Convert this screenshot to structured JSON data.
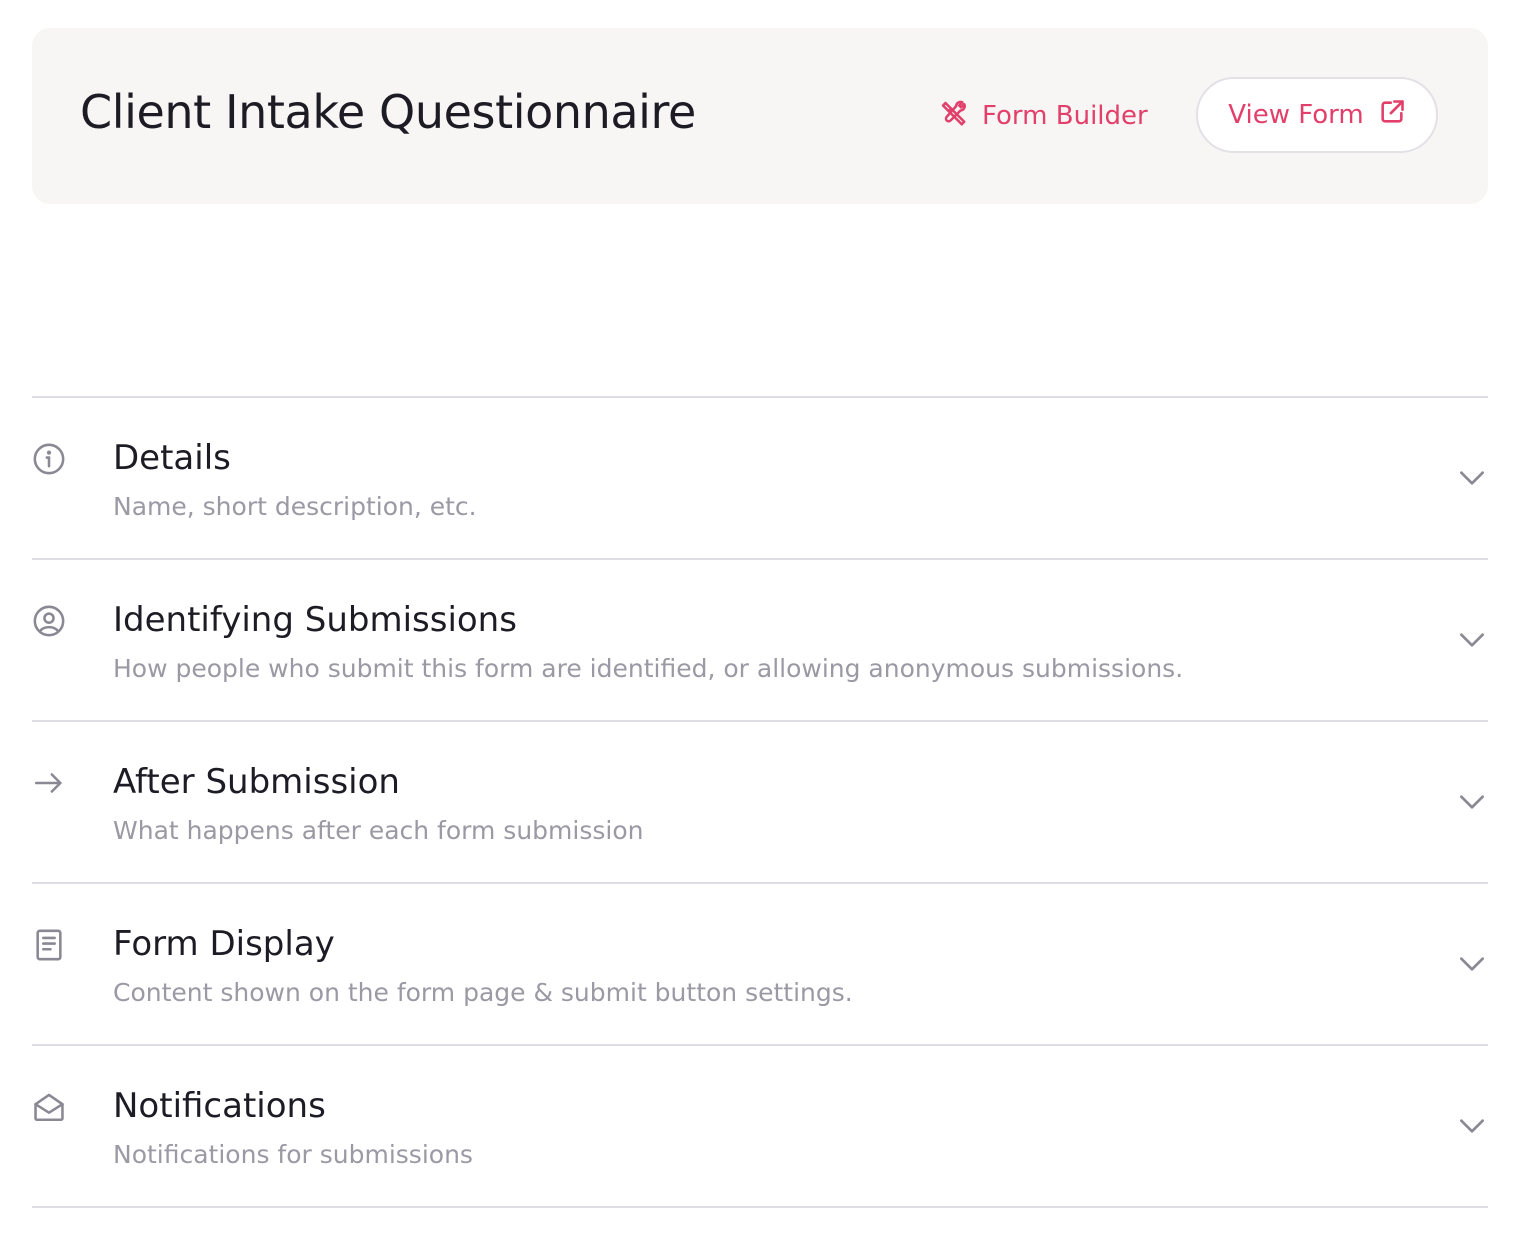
{
  "header": {
    "title": "Client Intake Questionnaire",
    "form_builder_label": "Form Builder",
    "view_form_label": "View Form",
    "accent_color": "#e23f6b"
  },
  "sections": [
    {
      "icon": "info-circle-icon",
      "title": "Details",
      "description": "Name, short description, etc."
    },
    {
      "icon": "user-circle-icon",
      "title": "Identifying Submissions",
      "description": "How people who submit this form are identified, or allowing anonymous submissions."
    },
    {
      "icon": "arrow-right-icon",
      "title": "After Submission",
      "description": "What happens after each form submission"
    },
    {
      "icon": "document-icon",
      "title": "Form Display",
      "description": "Content shown on the form page & submit button settings."
    },
    {
      "icon": "envelope-open-icon",
      "title": "Notifications",
      "description": "Notifications for submissions"
    }
  ]
}
